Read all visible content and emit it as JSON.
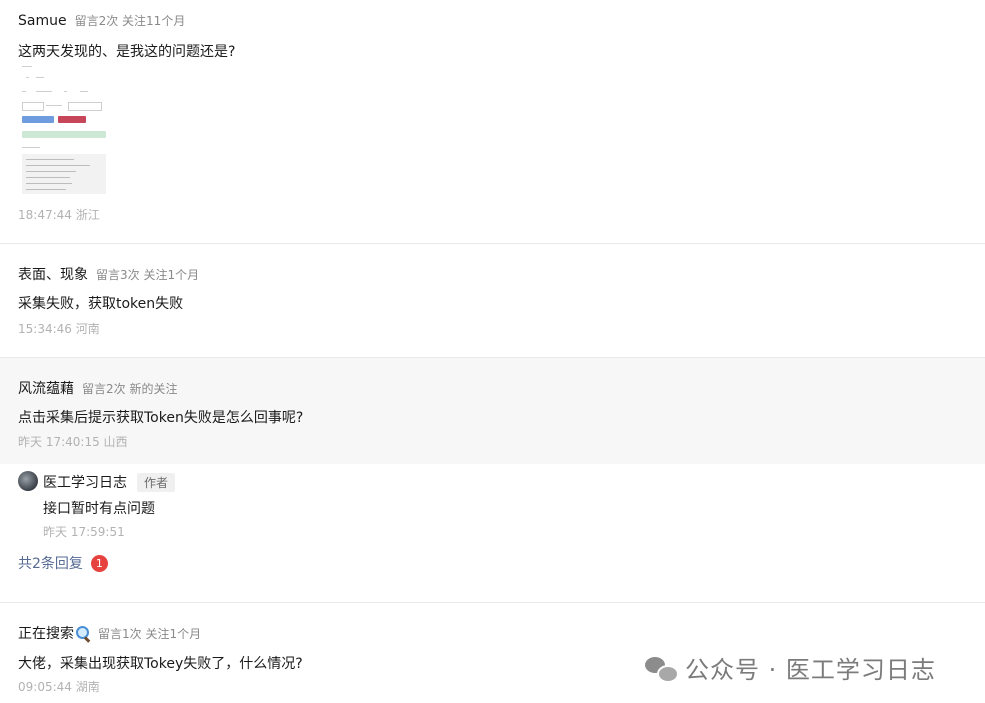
{
  "comments": [
    {
      "username": "Samue",
      "stats": "留言2次 关注11个月",
      "text": "这两天发现的、是我这的问题还是?",
      "time": "18:47:44 浙江",
      "has_image": true
    },
    {
      "username": "表面、现象",
      "stats": "留言3次 关注1个月",
      "text": "采集失败，获取token失败",
      "time": "15:34:46 河南"
    },
    {
      "username": "风流蕴藉",
      "stats": "留言2次 新的关注",
      "text": "点击采集后提示获取Token失败是怎么回事呢?",
      "time": "昨天 17:40:15 山西",
      "reply": {
        "author": "医工学习日志",
        "tag": "作者",
        "text": "接口暂时有点问题",
        "time": "昨天 17:59:51"
      },
      "replies_link": "共2条回复",
      "replies_badge": "1"
    },
    {
      "username": "正在搜索",
      "username_icon": "magnifier-emoji-icon",
      "stats": "留言1次 关注1个月",
      "text": "大佬，采集出现获取Tokey失败了，什么情况?",
      "time": "09:05:44 湖南"
    }
  ],
  "watermark": {
    "icon": "wechat-icon",
    "text": "公众号 · 医工学习日志"
  }
}
